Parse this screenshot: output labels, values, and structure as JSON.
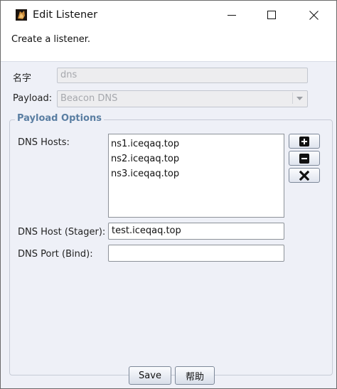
{
  "window": {
    "title": "Edit Listener"
  },
  "header": {
    "description": "Create a listener."
  },
  "form": {
    "name_label": "名字",
    "name_value": "dns",
    "payload_label": "Payload:",
    "payload_value": "Beacon DNS"
  },
  "payload_options": {
    "legend": "Payload Options",
    "dns_hosts_label": "DNS Hosts:",
    "dns_hosts": [
      "ns1.iceqaq.top",
      "ns2.iceqaq.top",
      "ns3.iceqaq.top"
    ],
    "dns_host_stager_label": "DNS Host (Stager):",
    "dns_host_stager_value": "test.iceqaq.top",
    "dns_port_label": "DNS Port (Bind):",
    "dns_port_value": ""
  },
  "buttons": {
    "save": "Save",
    "help": "帮助"
  },
  "colors": {
    "legend": "#5a7ea2",
    "content_bg": "#eef0f7",
    "icon_fg": "#111111"
  },
  "icons": [
    "app-icon",
    "minimize-icon",
    "maximize-icon",
    "close-icon",
    "add-icon",
    "remove-icon",
    "clear-icon",
    "dropdown-arrow-icon"
  ]
}
